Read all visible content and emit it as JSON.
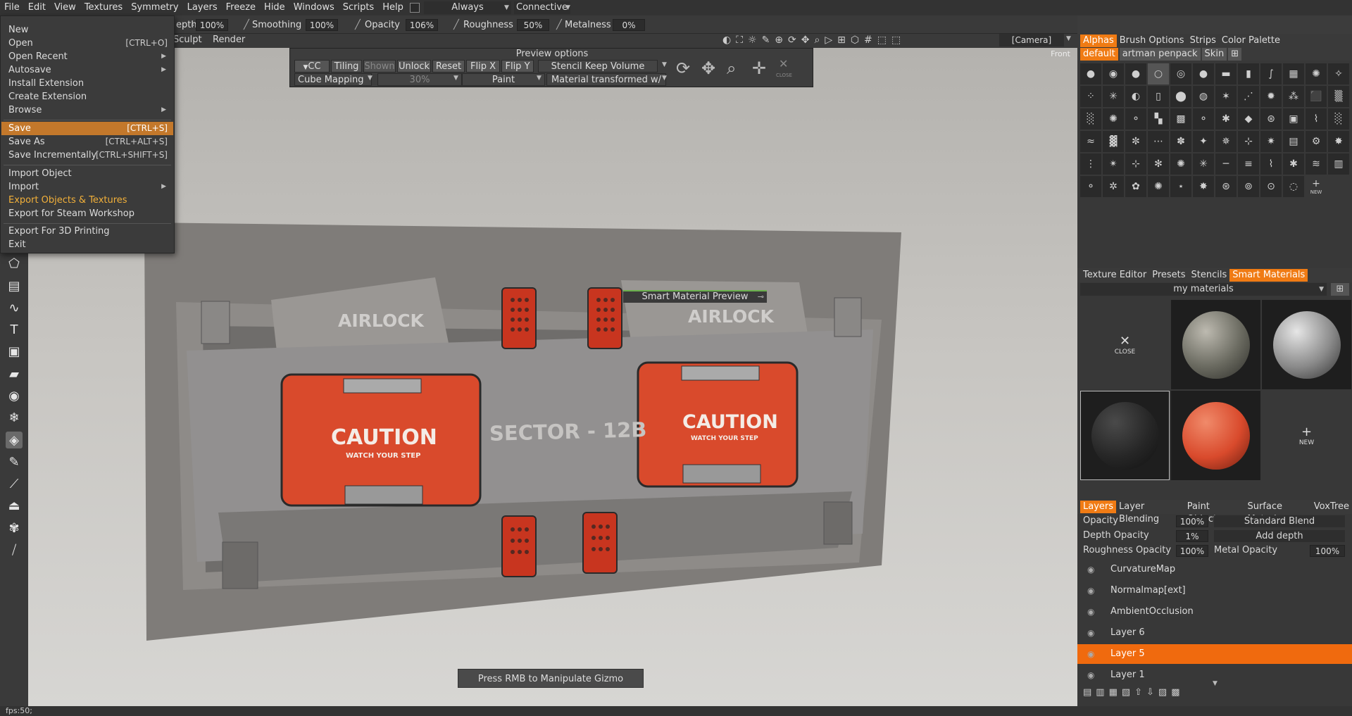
{
  "menubar": {
    "items": [
      "File",
      "Edit",
      "View",
      "Textures",
      "Symmetry",
      "Layers",
      "Freeze",
      "Hide",
      "Windows",
      "Scripts",
      "Help"
    ],
    "always_label": "Always",
    "connective_label": "Connective Picki"
  },
  "toolbar": {
    "depth_label": "epth",
    "depth_value": "100%",
    "smoothing_label": "Smoothing",
    "smoothing_value": "100%",
    "opacity_label": "Opacity",
    "opacity_value": "106%",
    "roughness_label": "Roughness",
    "roughness_value": "50%",
    "metalness_label": "Metalness",
    "metalness_value": "0%",
    "camera_label": "[Camera]"
  },
  "subtool": {
    "sculpt": "Sculpt",
    "render": "Render"
  },
  "file_menu": {
    "new": "New",
    "open": "Open",
    "open_sc": "[CTRL+O]",
    "open_recent": "Open Recent",
    "autosave": "Autosave",
    "install_extension": "Install Extension",
    "create_extension": "Create Extension",
    "browse": "Browse",
    "save": "Save",
    "save_sc": "[CTRL+S]",
    "save_as": "Save As",
    "save_as_sc": "[CTRL+ALT+S]",
    "save_incr": "Save Incrementally",
    "save_incr_sc": "[CTRL+SHIFT+S]",
    "import_object": "Import Object",
    "import": "Import",
    "export_objects": "Export Objects & Textures",
    "export_steam": "Export for Steam Workshop",
    "export_3d": "Export For 3D Printing",
    "exit": "Exit"
  },
  "preview_options": {
    "title": "Preview options",
    "cc": "CC",
    "tiling": "Tiling",
    "shown": "Shown",
    "unlock": "Unlock",
    "reset": "Reset",
    "flip_x": "Flip X",
    "flip_y": "Flip Y",
    "stencil": "Stencil Keep Volume",
    "cube_mapping": "Cube Mapping",
    "percent": "30%",
    "paint": "Paint",
    "material_transformed": "Material transformed w/",
    "close": "CLOSE"
  },
  "viewport": {
    "front_label": "Front",
    "gizmo_hint": "Press RMB to Manipulate Gizmo",
    "smart_material_preview": "Smart Material Preview",
    "airlock_left": "AIRLOCK",
    "airlock_right": "AIRLOCK",
    "caution_left": "CAUTION",
    "caution_right": "CAUTION",
    "watch_left": "WATCH YOUR STEP",
    "watch_right": "WATCH YOUR STEP",
    "sector": "SECTOR - 12B"
  },
  "alpha_panel": {
    "tabs": [
      "Alphas",
      "Brush Options",
      "Strips",
      "Color Palette"
    ],
    "sets": [
      "default",
      "artman penpack",
      "Skin"
    ],
    "new_label": "NEW"
  },
  "materials_panel": {
    "tabs": [
      "Texture Editor",
      "Presets",
      "Stencils",
      "Smart Materials"
    ],
    "folder": "my materials",
    "close_label": "CLOSE",
    "new_label": "NEW"
  },
  "layers_panel": {
    "tabs": [
      "Layers",
      "Layer Blending",
      "Paint Objects",
      "Surface Materi",
      "VoxTree"
    ],
    "opacity_label": "Opacity",
    "opacity_value": "100%",
    "blend_mode": "Standard Blend",
    "depth_opacity_label": "Depth Opacity",
    "depth_opacity_value": "1%",
    "depth_mode": "Add depth",
    "roughness_opacity_label": "Roughness Opacity",
    "roughness_opacity_value": "100%",
    "metal_opacity_label": "Metal Opacity",
    "metal_opacity_value": "100%",
    "layers": [
      "CurvatureMap",
      "Normalmap[ext]",
      "AmbientOcclusion",
      "Layer 6",
      "Layer 5",
      "Layer 1"
    ]
  },
  "status": {
    "fps": "fps:50;"
  },
  "colors": {
    "accent": "#f07b14",
    "highlight": "#c3782b",
    "caution_red": "#d94a2c"
  }
}
